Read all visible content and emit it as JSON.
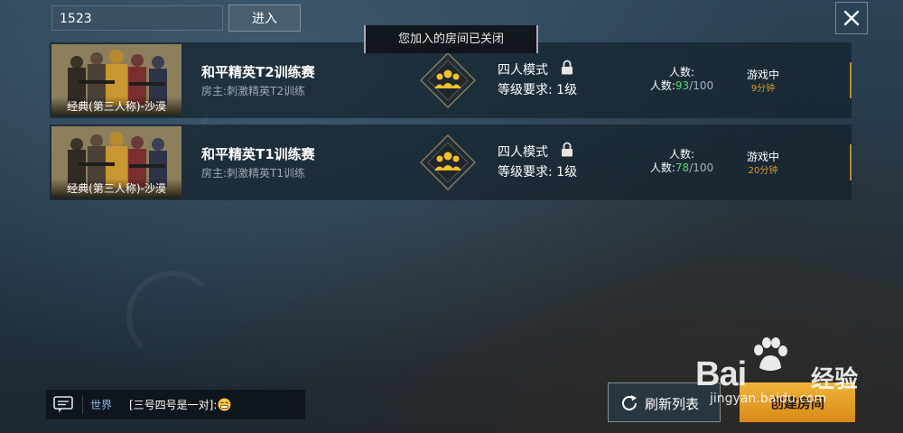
{
  "search": {
    "value": "1523",
    "enter_label": "进入"
  },
  "toast": "您加入的房间已关闭",
  "rooms": [
    {
      "map_label": "经典(第三人称)-沙漠",
      "name": "和平精英T2训练赛",
      "host": "房主:刺激精英T2训练",
      "mode": "四人模式",
      "level_req": "等级要求: 1级",
      "count_title": "人数:",
      "count_prefix": "人数:",
      "count_current": "93",
      "count_max": "/100",
      "status": "游戏中",
      "status_time": "9分钟"
    },
    {
      "map_label": "经典(第三人称)-沙漠",
      "name": "和平精英T1训练赛",
      "host": "房主:刺激精英T1训练",
      "mode": "四人模式",
      "level_req": "等级要求: 1级",
      "count_title": "人数:",
      "count_prefix": "人数:",
      "count_current": "78",
      "count_max": "/100",
      "status": "游戏中",
      "status_time": "20分钟"
    }
  ],
  "chat": {
    "channel": "世界",
    "message": "[三号四号是一对]:"
  },
  "buttons": {
    "refresh": "刷新列表",
    "create": "创建房间"
  },
  "watermark": {
    "brand": "Bai",
    "brand_cn": "经验",
    "url": "jingyan.baidu.com"
  },
  "colors": {
    "accent_gold": "#d99a2c",
    "count_green": "#4ddc68",
    "create_button": "#f0b43a",
    "channel_blue": "#8fb8e6"
  },
  "icons": [
    "close-icon",
    "squad-mode-icon",
    "lock-icon",
    "chat-icon",
    "emoji-icon",
    "refresh-icon",
    "baidu-paw-icon"
  ]
}
